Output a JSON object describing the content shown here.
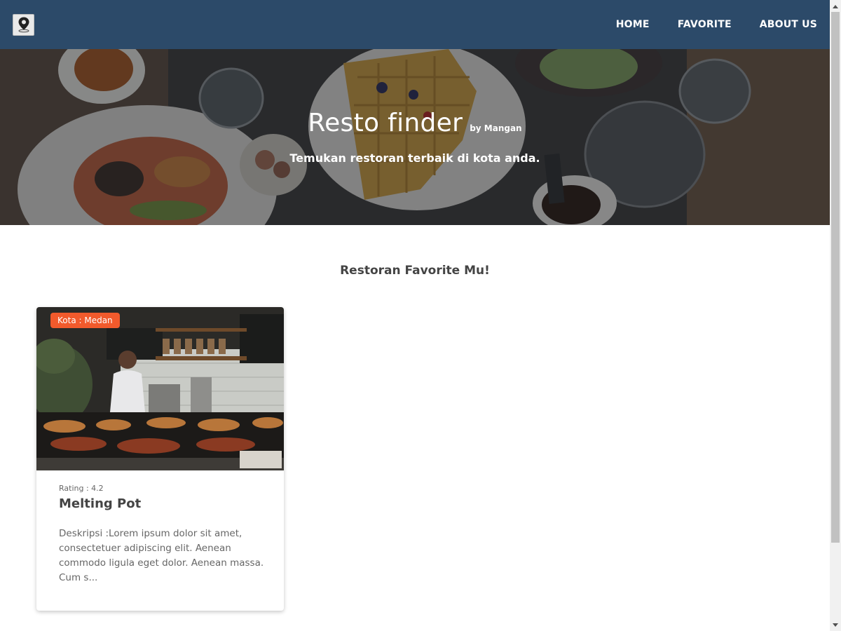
{
  "header": {
    "logo_icon": "map-pin-logo-icon",
    "nav": [
      {
        "label": "HOME"
      },
      {
        "label": "FAVORITE"
      },
      {
        "label": "ABOUT US"
      }
    ],
    "background_color": "#2c4a69"
  },
  "hero": {
    "title": "Resto finder",
    "byline": "by Mangan",
    "tagline": "Temukan restoran terbaik di kota anda."
  },
  "favorites": {
    "title": "Restoran Favorite Mu!",
    "restaurants": [
      {
        "city_badge": "Kota : Medan",
        "rating": "Rating : 4.2",
        "name": "Melting Pot",
        "description": "Deskripsi :Lorem ipsum dolor sit amet, consectetuer adipiscing elit. Aenean commodo ligula eget dolor. Aenean massa. Cum s..."
      }
    ]
  },
  "colors": {
    "badge": "#f25a2c",
    "header": "#2c4a69"
  }
}
